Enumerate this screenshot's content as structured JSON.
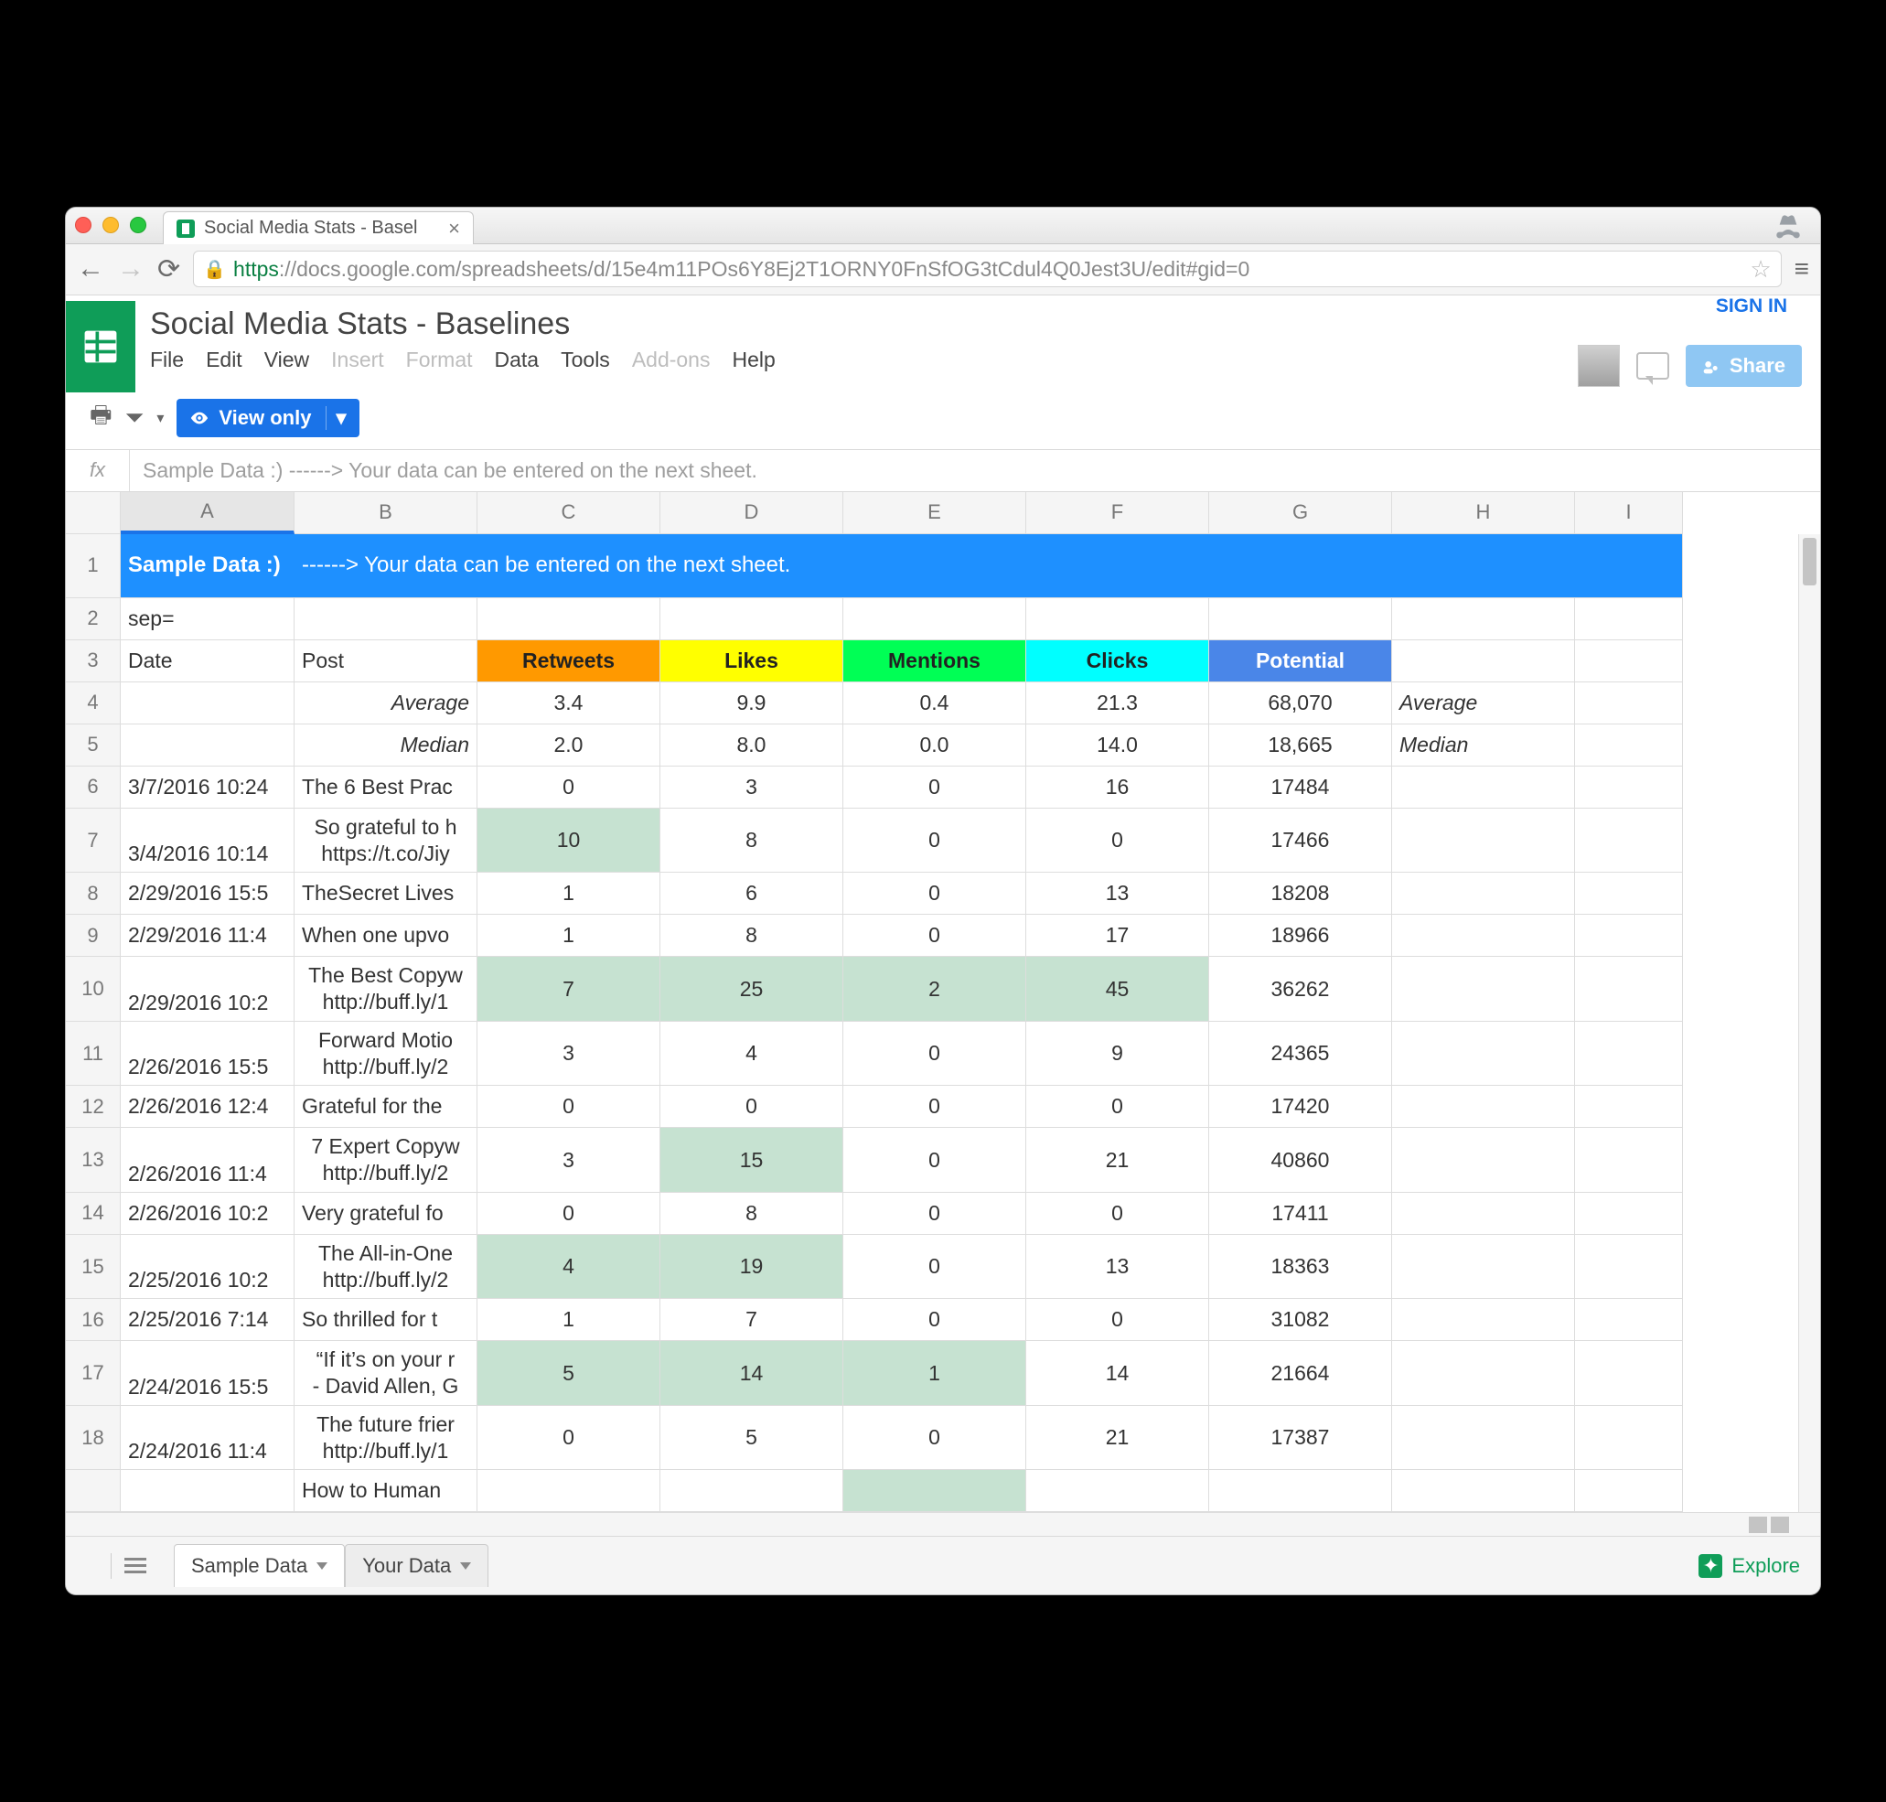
{
  "browser": {
    "tab_title": "Social Media Stats - Basel",
    "url_https": "https",
    "url_rest": "://docs.google.com/spreadsheets/d/15e4m11POs6Y8Ej2T1ORNY0FnSfOG3tCdul4Q0Jest3U/edit#gid=0"
  },
  "docs": {
    "title": "Social Media Stats - Baselines",
    "menus": {
      "file": "File",
      "edit": "Edit",
      "view": "View",
      "insert": "Insert",
      "format": "Format",
      "data": "Data",
      "tools": "Tools",
      "addons": "Add-ons",
      "help": "Help"
    },
    "sign_in": "SIGN IN",
    "share": "Share",
    "view_only": "View only"
  },
  "fx": "Sample Data :)  ------> Your data can be entered on the next sheet.",
  "cols": {
    "A": "A",
    "B": "B",
    "C": "C",
    "D": "D",
    "E": "E",
    "F": "F",
    "G": "G",
    "H": "H",
    "I": "I"
  },
  "banner": {
    "a": "Sample Data :)",
    "b": "------> Your data can be entered on the next sheet."
  },
  "r2": {
    "a": "sep="
  },
  "r3": {
    "a": "Date",
    "b": "Post",
    "c": "Retweets",
    "d": "Likes",
    "e": "Mentions",
    "f": "Clicks",
    "g": "Potential"
  },
  "r4": {
    "b": "Average",
    "c": "3.4",
    "d": "9.9",
    "e": "0.4",
    "f": "21.3",
    "g": "68,070",
    "h": "Average"
  },
  "r5": {
    "b": "Median",
    "c": "2.0",
    "d": "8.0",
    "e": "0.0",
    "f": "14.0",
    "g": "18,665",
    "h": "Median"
  },
  "rows": [
    {
      "n": "6",
      "date": "3/7/2016 10:24",
      "post": "The 6 Best Prac",
      "c": "0",
      "d": "3",
      "e": "0",
      "f": "16",
      "g": "17484",
      "two": false
    },
    {
      "n": "7",
      "date": "3/4/2016 10:14",
      "post1": "So grateful to h",
      "post2": "https://t.co/Jiy",
      "c": "10",
      "d": "8",
      "e": "0",
      "f": "0",
      "g": "17466",
      "two": true,
      "hlc": true
    },
    {
      "n": "8",
      "date": "2/29/2016 15:5",
      "post": "TheSecret Lives",
      "c": "1",
      "d": "6",
      "e": "0",
      "f": "13",
      "g": "18208",
      "two": false
    },
    {
      "n": "9",
      "date": "2/29/2016 11:4",
      "post": "When one upvo",
      "c": "1",
      "d": "8",
      "e": "0",
      "f": "17",
      "g": "18966",
      "two": false
    },
    {
      "n": "10",
      "date": "2/29/2016 10:2",
      "post1": "The Best Copyw",
      "post2": "http://buff.ly/1",
      "c": "7",
      "d": "25",
      "e": "2",
      "f": "45",
      "g": "36262",
      "two": true,
      "hlc": true,
      "hld": true,
      "hle": true,
      "hlf": true
    },
    {
      "n": "11",
      "date": "2/26/2016 15:5",
      "post1": "Forward Motio",
      "post2": "http://buff.ly/2",
      "c": "3",
      "d": "4",
      "e": "0",
      "f": "9",
      "g": "24365",
      "two": true
    },
    {
      "n": "12",
      "date": "2/26/2016 12:4",
      "post": "Grateful for the",
      "c": "0",
      "d": "0",
      "e": "0",
      "f": "0",
      "g": "17420",
      "two": false
    },
    {
      "n": "13",
      "date": "2/26/2016 11:4",
      "post1": "7 Expert Copyw",
      "post2": "http://buff.ly/2",
      "c": "3",
      "d": "15",
      "e": "0",
      "f": "21",
      "g": "40860",
      "two": true,
      "hld": true
    },
    {
      "n": "14",
      "date": "2/26/2016 10:2",
      "post": "Very grateful fo",
      "c": "0",
      "d": "8",
      "e": "0",
      "f": "0",
      "g": "17411",
      "two": false
    },
    {
      "n": "15",
      "date": "2/25/2016 10:2",
      "post1": "The All-in-One",
      "post2": "http://buff.ly/2",
      "c": "4",
      "d": "19",
      "e": "0",
      "f": "13",
      "g": "18363",
      "two": true,
      "hlc": true,
      "hld": true
    },
    {
      "n": "16",
      "date": "2/25/2016 7:14",
      "post": "So thrilled for t",
      "c": "1",
      "d": "7",
      "e": "0",
      "f": "0",
      "g": "31082",
      "two": false
    },
    {
      "n": "17",
      "date": "2/24/2016 15:5",
      "post1": "“If it’s on your r",
      "post2": "- David Allen, G",
      "c": "5",
      "d": "14",
      "e": "1",
      "f": "14",
      "g": "21664",
      "two": true,
      "hlc": true,
      "hld": true,
      "hle": true
    },
    {
      "n": "18",
      "date": "2/24/2016 11:4",
      "post1": "The future frier",
      "post2": "http://buff.ly/1",
      "c": "0",
      "d": "5",
      "e": "0",
      "f": "21",
      "g": "17387",
      "two": true
    }
  ],
  "lastrow": {
    "post": "How to Human"
  },
  "tabs": {
    "t1": "Sample Data",
    "t2": "Your Data"
  },
  "explore": "Explore"
}
